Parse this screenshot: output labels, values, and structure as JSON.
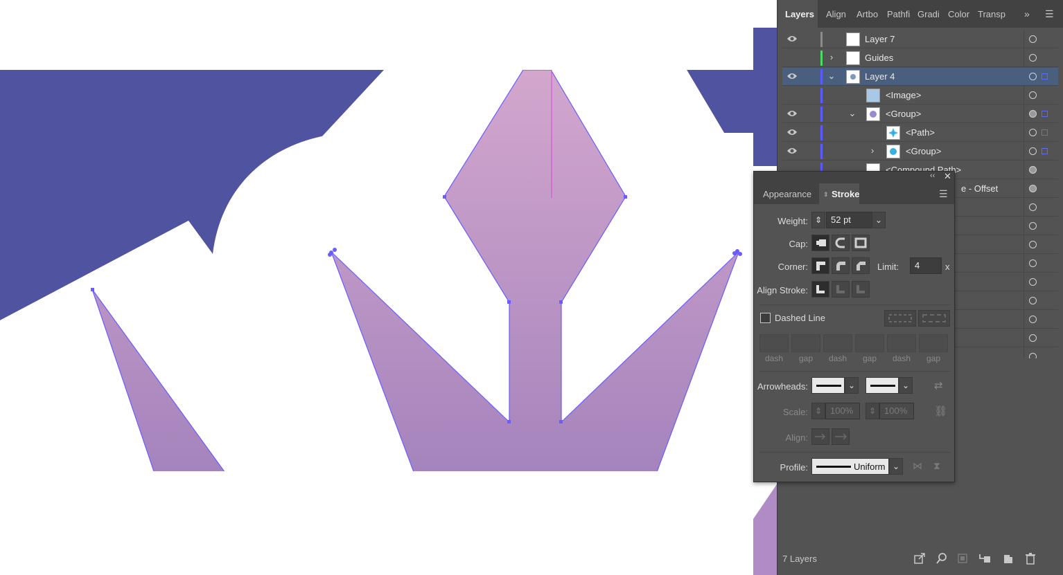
{
  "layers_panel": {
    "tabs": [
      "Layers",
      "Align",
      "Artbo",
      "Pathfi",
      "Gradi",
      "Color",
      "Transp"
    ],
    "rows": [
      {
        "name": "Layer 7",
        "visible": true,
        "expandable": false,
        "color": "#8a8a8a"
      },
      {
        "name": "Guides",
        "visible": false,
        "expandable": true,
        "expanded": false,
        "color": "#4cd964"
      },
      {
        "name": "Layer 4",
        "visible": true,
        "expandable": true,
        "expanded": true,
        "color": "#5a5aff",
        "selected": true
      },
      {
        "name": "<Image>",
        "visible": false,
        "indent": 1,
        "color": "#5a5aff"
      },
      {
        "name": "<Group>",
        "visible": true,
        "indent": 1,
        "expandable": true,
        "expanded": true,
        "color": "#5a5aff"
      },
      {
        "name": "<Path>",
        "visible": true,
        "indent": 2,
        "color": "#5a5aff"
      },
      {
        "name": "<Group>",
        "visible": true,
        "indent": 2,
        "expandable": true,
        "expanded": false,
        "color": "#5a5aff"
      },
      {
        "name": "<Compound Path>",
        "visible": false,
        "indent": 1,
        "color": "#5a5aff"
      },
      {
        "name": "e - Offset",
        "visible": false,
        "indent": 1,
        "color": "#5a5aff"
      }
    ],
    "count_label": "7 Layers"
  },
  "stroke_panel": {
    "tabs": [
      "Appearance",
      "Stroke"
    ],
    "weight_label": "Weight:",
    "weight_value": "52 pt",
    "cap_label": "Cap:",
    "corner_label": "Corner:",
    "limit_label": "Limit:",
    "limit_value": "4",
    "limit_unit": "x",
    "align_stroke_label": "Align Stroke:",
    "dashed_line_label": "Dashed Line",
    "dashed_line_checked": false,
    "dash_labels": [
      "dash",
      "gap",
      "dash",
      "gap",
      "dash",
      "gap"
    ],
    "arrowheads_label": "Arrowheads:",
    "scale_label": "Scale:",
    "scale_values": [
      "100%",
      "100%"
    ],
    "align_label": "Align:",
    "profile_label": "Profile:",
    "profile_value": "Uniform"
  },
  "colors": {
    "artwork_blue": "#4f53a0",
    "gradient_top": "#d3a7cd",
    "gradient_bottom": "#a584bd",
    "path_outline": "#6a5cff",
    "guide_magenta": "#e040e0",
    "panel_bg": "#535353",
    "tab_bg": "#424242"
  }
}
